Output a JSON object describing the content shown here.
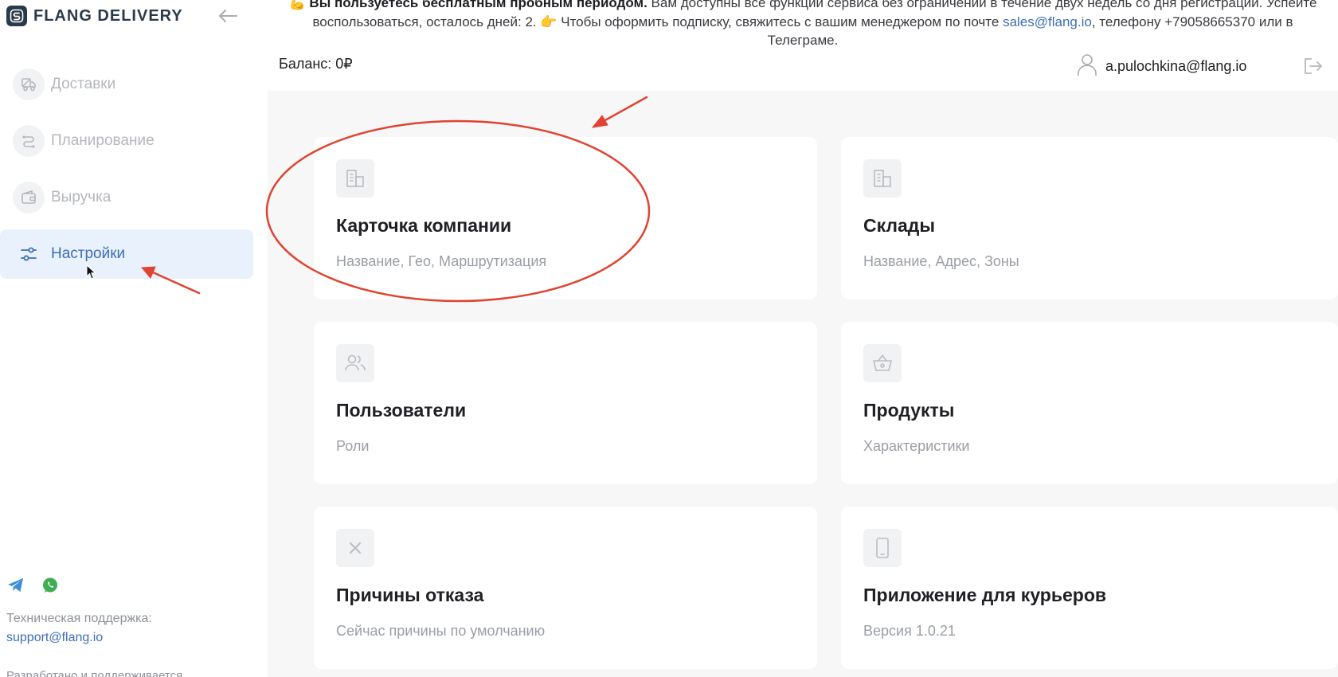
{
  "brand": {
    "name": "FLANG DELIVERY"
  },
  "sidebar": {
    "items": [
      {
        "label": "Доставки",
        "icon": "truck-icon",
        "active": false
      },
      {
        "label": "Планирование",
        "icon": "route-icon",
        "active": false
      },
      {
        "label": "Выручка",
        "icon": "wallet-icon",
        "active": false
      },
      {
        "label": "Настройки",
        "icon": "sliders-icon",
        "active": true
      }
    ],
    "support_label": "Техническая поддержка:",
    "support_email": "support@flang.io",
    "dev_note": "Разработано и поддерживается"
  },
  "banner": {
    "emoji_lead": "💪",
    "bold": "Вы пользуетесь бесплатным пробным периодом.",
    "text1": " Вам доступны все функции сервиса без ограничений в течение двух недель со дня регистрации. Успейте воспользоваться, осталось дней: 2. ",
    "emoji_point": "👉",
    "text2": " Чтобы оформить подписку, свяжитесь с вашим менеджером по почте ",
    "email": "sales@flang.io",
    "text3": ", телефону +79058665370 или в Телеграме."
  },
  "header": {
    "balance": "Баланс: 0₽",
    "user_email": "a.pulochkina@flang.io"
  },
  "cards": [
    {
      "title": "Карточка компании",
      "subtitle": "Название, Гео, Маршрутизация",
      "icon": "building-icon"
    },
    {
      "title": "Склады",
      "subtitle": "Название, Адрес, Зоны",
      "icon": "warehouse-icon"
    },
    {
      "title": "Пользователи",
      "subtitle": "Роли",
      "icon": "users-icon"
    },
    {
      "title": "Продукты",
      "subtitle": "Характеристики",
      "icon": "basket-icon"
    },
    {
      "title": "Причины отказа",
      "subtitle": "Сейчас причины по умолчанию",
      "icon": "close-icon"
    },
    {
      "title": "Приложение для курьеров",
      "subtitle": "Версия 1.0.21",
      "icon": "phone-icon"
    }
  ],
  "colors": {
    "accent": "#3d6fb5",
    "active_bg": "#e9f1fd",
    "annotation": "#e0432f"
  }
}
